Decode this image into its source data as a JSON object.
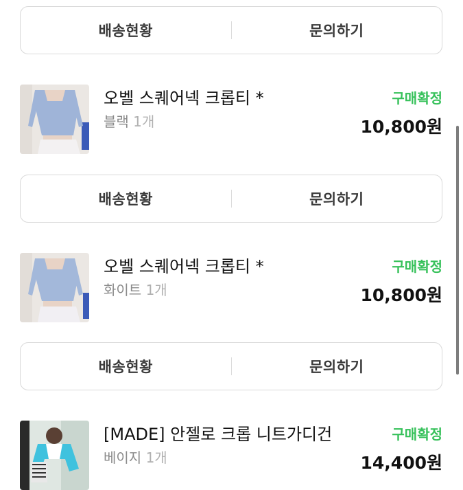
{
  "actions": {
    "shipping_label": "배송현황",
    "inquiry_label": "문의하기"
  },
  "orders": [
    {
      "name": "오벨 스퀘어넥 크롭티 *",
      "option": "블랙",
      "qty": "1개",
      "status": "구매확정",
      "price": "10,800원",
      "image": "blue-square-neck-crop-top-photo"
    },
    {
      "name": "오벨 스퀘어넥 크롭티 *",
      "option": "화이트",
      "qty": "1개",
      "status": "구매확정",
      "price": "10,800원",
      "image": "blue-square-neck-crop-top-photo"
    },
    {
      "name": "[MADE] 안젤로 크롭 니트가디건",
      "option": "베이지",
      "qty": "1개",
      "status": "구매확정",
      "price": "14,400원",
      "image": "knit-cardigan-photo"
    }
  ],
  "colors": {
    "status_green": "#37c15b",
    "border": "#d9d9d9",
    "option_gray": "#8a8a8a"
  }
}
